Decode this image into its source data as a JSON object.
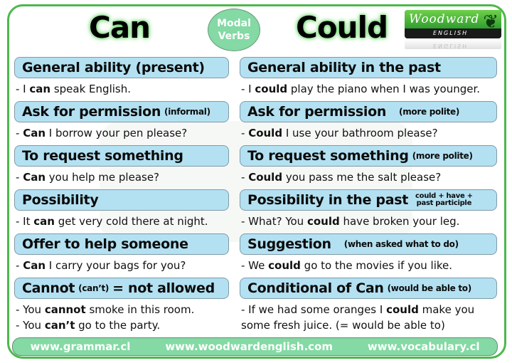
{
  "titles": {
    "left": "Can",
    "right": "Could"
  },
  "badge": {
    "line1": "Modal",
    "line2": "Verbs"
  },
  "logo": {
    "brand": "Woodward",
    "sub": "ENGLISH",
    "icon": "fern-icon"
  },
  "left": [
    {
      "heading": "General ability (present)",
      "note": "",
      "examples": [
        {
          "pre": "- I ",
          "bold": "can",
          "post": " speak English."
        }
      ]
    },
    {
      "heading": "Ask for permission",
      "note": "(informal)",
      "examples": [
        {
          "pre": "- ",
          "bold": "Can",
          "post": " I borrow your pen please?"
        }
      ]
    },
    {
      "heading": "To request something",
      "note": "",
      "examples": [
        {
          "pre": "- ",
          "bold": "Can",
          "post": " you help me please?"
        }
      ]
    },
    {
      "heading": "Possibility",
      "note": "",
      "examples": [
        {
          "pre": "- It ",
          "bold": "can",
          "post": " get very cold there at night."
        }
      ]
    },
    {
      "heading": "Offer to help someone",
      "note": "",
      "examples": [
        {
          "pre": "- ",
          "bold": "Can",
          "post": " I carry your bags for you?"
        }
      ]
    },
    {
      "heading": "Cannot",
      "note": "(can’t)",
      "heading_tail": "= not allowed",
      "examples": [
        {
          "pre": "- You ",
          "bold": "cannot",
          "post": " smoke in this room."
        },
        {
          "pre": "- You ",
          "bold": "can’t",
          "post": " go to the party."
        }
      ]
    }
  ],
  "right": [
    {
      "heading": "General ability in the past",
      "note": "",
      "examples": [
        {
          "pre": "- I ",
          "bold": "could",
          "post": " play the piano when I was younger."
        }
      ]
    },
    {
      "heading": "Ask for permission",
      "note": "(more polite)",
      "examples": [
        {
          "pre": "- ",
          "bold": "Could",
          "post": " I use your bathroom please?"
        }
      ]
    },
    {
      "heading": "To request something",
      "note": "(more polite)",
      "examples": [
        {
          "pre": "- ",
          "bold": "Could",
          "post": " you pass me the salt please?"
        }
      ]
    },
    {
      "heading": "Possibility in the past",
      "note_line1": "could + have +",
      "note_line2": "past participle",
      "examples": [
        {
          "pre": "- What? You ",
          "bold": "could",
          "post": " have broken your leg."
        }
      ]
    },
    {
      "heading": "Suggestion",
      "note": "(when asked what to do)",
      "examples": [
        {
          "pre": "- We ",
          "bold": "could",
          "post": " go to the movies if you like."
        }
      ]
    },
    {
      "heading": "Conditional of Can",
      "note": "(would be able to)",
      "examples": [
        {
          "pre": "- If we had some oranges I ",
          "bold": "could",
          "post": " make you"
        },
        {
          "pre": "",
          "bold": "",
          "post": "some fresh juice. (= would be able to)"
        }
      ]
    }
  ],
  "footer": {
    "links": [
      "www.grammar.cl",
      "www.woodwardenglish.com",
      "www.vocabulary.cl"
    ]
  },
  "colors": {
    "border": "#4cb84c",
    "header_fill": "#b3e1f2",
    "badge_fill": "#84d9a4",
    "footer_fill": "#84d9a4"
  }
}
